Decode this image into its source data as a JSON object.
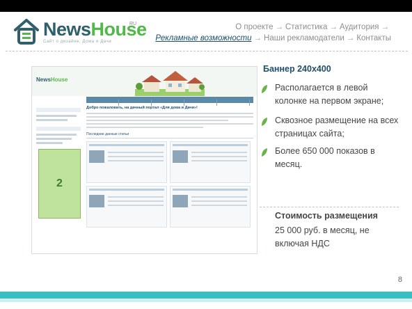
{
  "logo": {
    "word1": "News",
    "word2": "House",
    "ru": "RU",
    "tagline": "Сайт о дизайне, Дома и Дачи"
  },
  "nav": {
    "items": [
      "О проекте",
      "Статистика",
      "Аудитория",
      "Рекламные возможности",
      "Наши рекламодатели",
      "Контакты"
    ],
    "active": "Рекламные возможности",
    "arrow": "→"
  },
  "site": {
    "logo_a": "News",
    "logo_b": "House",
    "welcome": "Добро пожаловать, на дачный портал «Для дома и Дачи»!",
    "section": "Последние данные статьи",
    "banner_number": "2"
  },
  "right": {
    "title": "Баннер 240x400",
    "bullets": [
      "Располагается в левой колонке на первом экране;",
      "Сквозное размещение на всех страницах сайта;",
      "Более 650 000 показов в месяц."
    ],
    "price_title": "Стоимость размещения",
    "price_text": "25 000 руб. в месяц, не включая НДС"
  },
  "page_number": "8",
  "colors": {
    "accent_teal": "#34bfc2",
    "leaf_green": "#6ab34a",
    "nav_active": "#1a4f6e"
  }
}
